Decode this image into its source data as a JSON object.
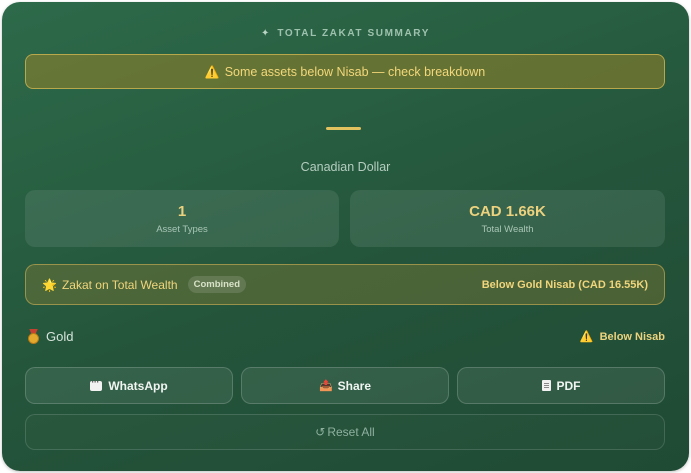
{
  "header": {
    "icon": "sparkle-icon",
    "glyph": "✦",
    "title": "TOTAL ZAKAT SUMMARY"
  },
  "alert": {
    "icon": "warning-icon",
    "glyph": "⚠️",
    "text": "Some assets below Nisab — check breakdown"
  },
  "currency": {
    "name": "Canadian Dollar"
  },
  "stats": [
    {
      "value": "1",
      "label": "Asset Types"
    },
    {
      "value": "CAD 1.66K",
      "label": "Total Wealth"
    }
  ],
  "zakat": {
    "icon": "star-icon",
    "glyph": "🌟",
    "title": "Zakat on Total Wealth",
    "badge": "Combined",
    "status": "Below Gold Nisab (CAD 16.55K)"
  },
  "asset": {
    "icon": "medal-icon",
    "name": "Gold",
    "status_icon": "warning-icon",
    "status_glyph": "⚠️",
    "status": "Below Nisab"
  },
  "actions": {
    "whatsapp": {
      "icon": "chat-icon",
      "label": "WhatsApp"
    },
    "share": {
      "icon": "share-tray-icon",
      "glyph": "📤",
      "label": "Share"
    },
    "pdf": {
      "icon": "document-icon",
      "label": "PDF"
    }
  },
  "reset": {
    "icon": "refresh-icon",
    "glyph": "↺",
    "label": "Reset All"
  },
  "colors": {
    "accent_gold": "#e2c15f",
    "card_green": "#2a6246"
  }
}
